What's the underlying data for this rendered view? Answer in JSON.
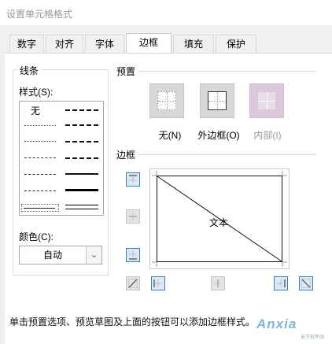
{
  "window": {
    "title": "设置单元格格式"
  },
  "tabs": [
    {
      "label": "数字",
      "active": false
    },
    {
      "label": "对齐",
      "active": false
    },
    {
      "label": "字体",
      "active": false
    },
    {
      "label": "边框",
      "active": true
    },
    {
      "label": "填充",
      "active": false
    },
    {
      "label": "保护",
      "active": false
    }
  ],
  "line": {
    "group_label": "线条",
    "style_label": "样式(S):",
    "style_none": "无",
    "color_label": "颜色(C):",
    "color_value": "自动"
  },
  "presets": {
    "label": "预置",
    "items": [
      {
        "label": "无(N)",
        "icon": "preset-none-icon",
        "enabled": true
      },
      {
        "label": "外边框(O)",
        "icon": "preset-outline-icon",
        "enabled": true
      },
      {
        "label": "内部(I)",
        "icon": "preset-inside-icon",
        "enabled": false
      }
    ]
  },
  "border": {
    "label": "边框",
    "preview_text": "文本",
    "buttons": [
      {
        "name": "border-top-button",
        "on": true
      },
      {
        "name": "border-inside-horizontal-button",
        "on": false
      },
      {
        "name": "border-bottom-button",
        "on": true
      },
      {
        "name": "border-diagonal-up-button",
        "on": false
      },
      {
        "name": "border-left-button",
        "on": true
      },
      {
        "name": "border-inside-vertical-button",
        "on": false
      },
      {
        "name": "border-right-button",
        "on": true
      },
      {
        "name": "border-diagonal-down-button",
        "on": true
      }
    ]
  },
  "hint": "单击预置选项、预览草图及上面的按钮可以添加边框样式。",
  "watermark": {
    "text": "Anxia",
    "sub": "安下软件站"
  },
  "colors": {
    "accent": "#3c7fb1",
    "tab_border": "#d9d9d9",
    "title": "#999999"
  }
}
